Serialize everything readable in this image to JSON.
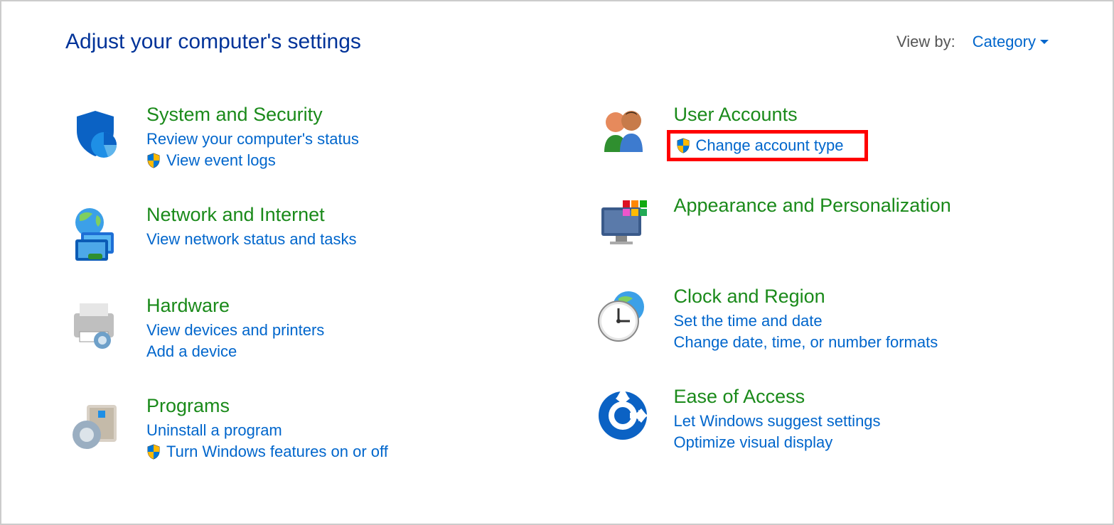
{
  "header": {
    "title": "Adjust your computer's settings",
    "view_by_label": "View by:",
    "view_by_value": "Category"
  },
  "left": [
    {
      "title": "System and Security",
      "tasks": [
        {
          "label": "Review your computer's status",
          "shield": false
        },
        {
          "label": "View event logs",
          "shield": true
        }
      ]
    },
    {
      "title": "Network and Internet",
      "tasks": [
        {
          "label": "View network status and tasks",
          "shield": false
        }
      ]
    },
    {
      "title": "Hardware",
      "tasks": [
        {
          "label": "View devices and printers",
          "shield": false
        },
        {
          "label": "Add a device",
          "shield": false
        }
      ]
    },
    {
      "title": "Programs",
      "tasks": [
        {
          "label": "Uninstall a program",
          "shield": false
        },
        {
          "label": "Turn Windows features on or off",
          "shield": true
        }
      ]
    }
  ],
  "right": [
    {
      "title": "User Accounts",
      "tasks": [
        {
          "label": "Change account type",
          "shield": true,
          "highlight": true
        }
      ]
    },
    {
      "title": "Appearance and Personalization",
      "tasks": []
    },
    {
      "title": "Clock and Region",
      "tasks": [
        {
          "label": "Set the time and date",
          "shield": false
        },
        {
          "label": "Change date, time, or number formats",
          "shield": false
        }
      ]
    },
    {
      "title": "Ease of Access",
      "tasks": [
        {
          "label": "Let Windows suggest settings",
          "shield": false
        },
        {
          "label": "Optimize visual display",
          "shield": false
        }
      ]
    }
  ]
}
